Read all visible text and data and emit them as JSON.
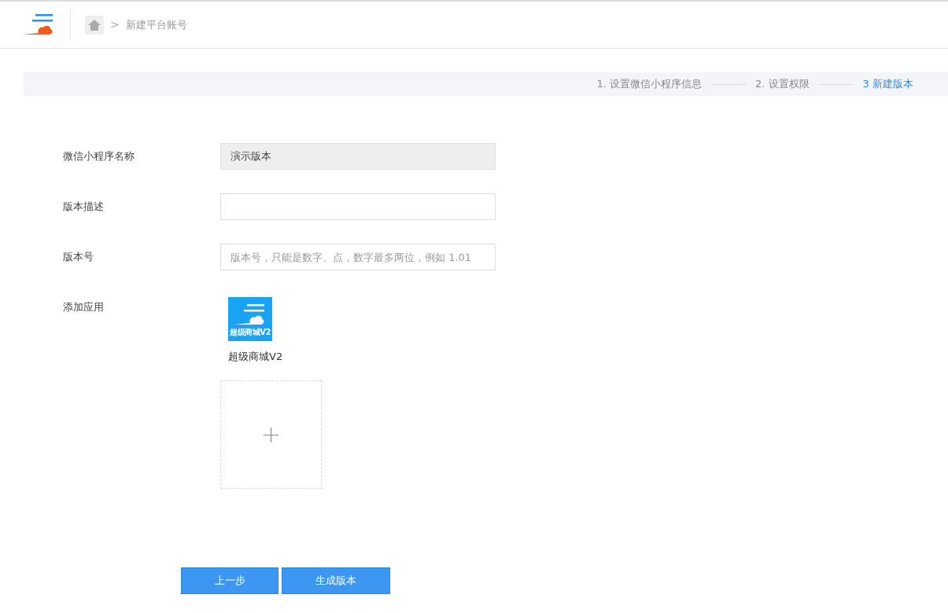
{
  "breadcrumb": {
    "separator": ">",
    "current": "新建平台账号"
  },
  "steps": [
    {
      "label": "1. 设置微信小程序信息",
      "selected": false
    },
    {
      "label": "2. 设置权限",
      "selected": false
    },
    {
      "label": "3 新建版本",
      "selected": true
    }
  ],
  "form": [
    {
      "kind": "readonly",
      "label": "微信小程序名称",
      "value": "演示版本"
    },
    {
      "kind": "input",
      "label": "版本描述"
    },
    {
      "kind": "input",
      "label": "版本号",
      "placeholder": "版本号，只能是数字、点，数字最多两位，例如 1.01"
    },
    {
      "kind": "apps",
      "label": "添加应用",
      "apps": [
        {
          "icon_text": "超级商城V2",
          "name": "超级商城V2"
        }
      ],
      "add_symbol": "+"
    }
  ],
  "buttons": [
    "上一步",
    "生成版本"
  ]
}
